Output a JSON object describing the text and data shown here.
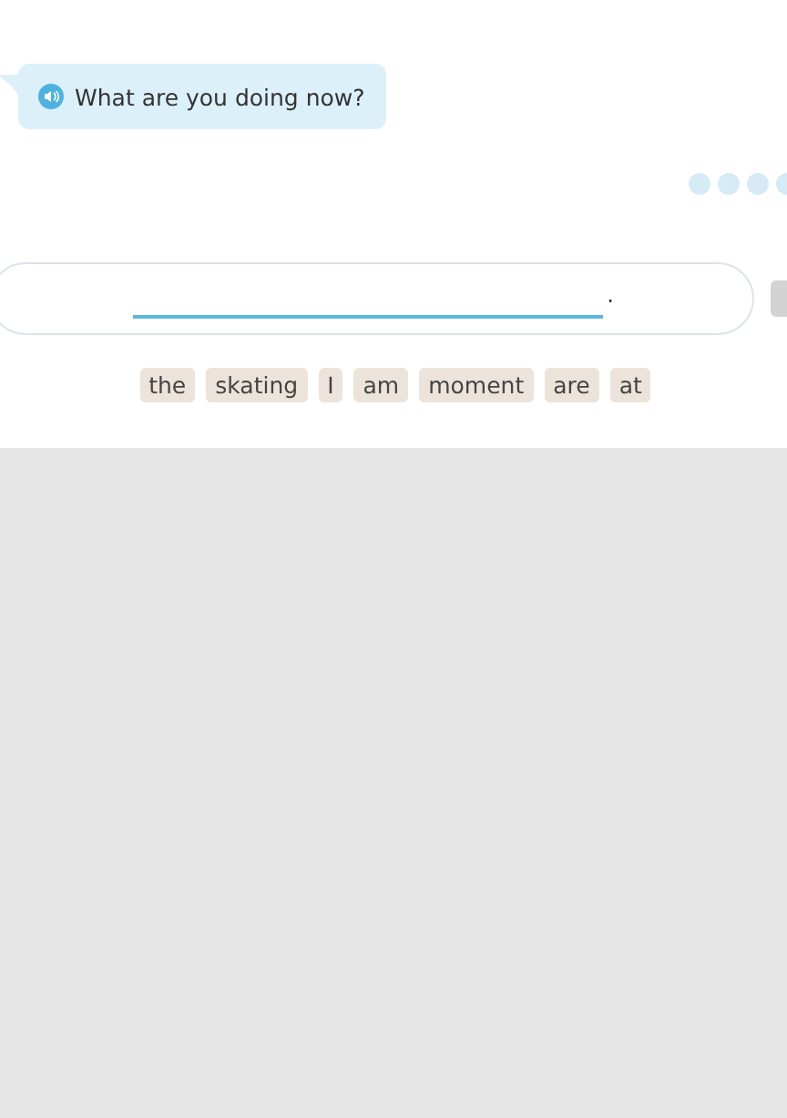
{
  "question": {
    "text": "What are you doing now?"
  },
  "answer": {
    "end_mark": "."
  },
  "word_bank": [
    {
      "text": "the"
    },
    {
      "text": "skating"
    },
    {
      "text": "I"
    },
    {
      "text": "am"
    },
    {
      "text": "moment"
    },
    {
      "text": "are"
    },
    {
      "text": "at"
    }
  ]
}
